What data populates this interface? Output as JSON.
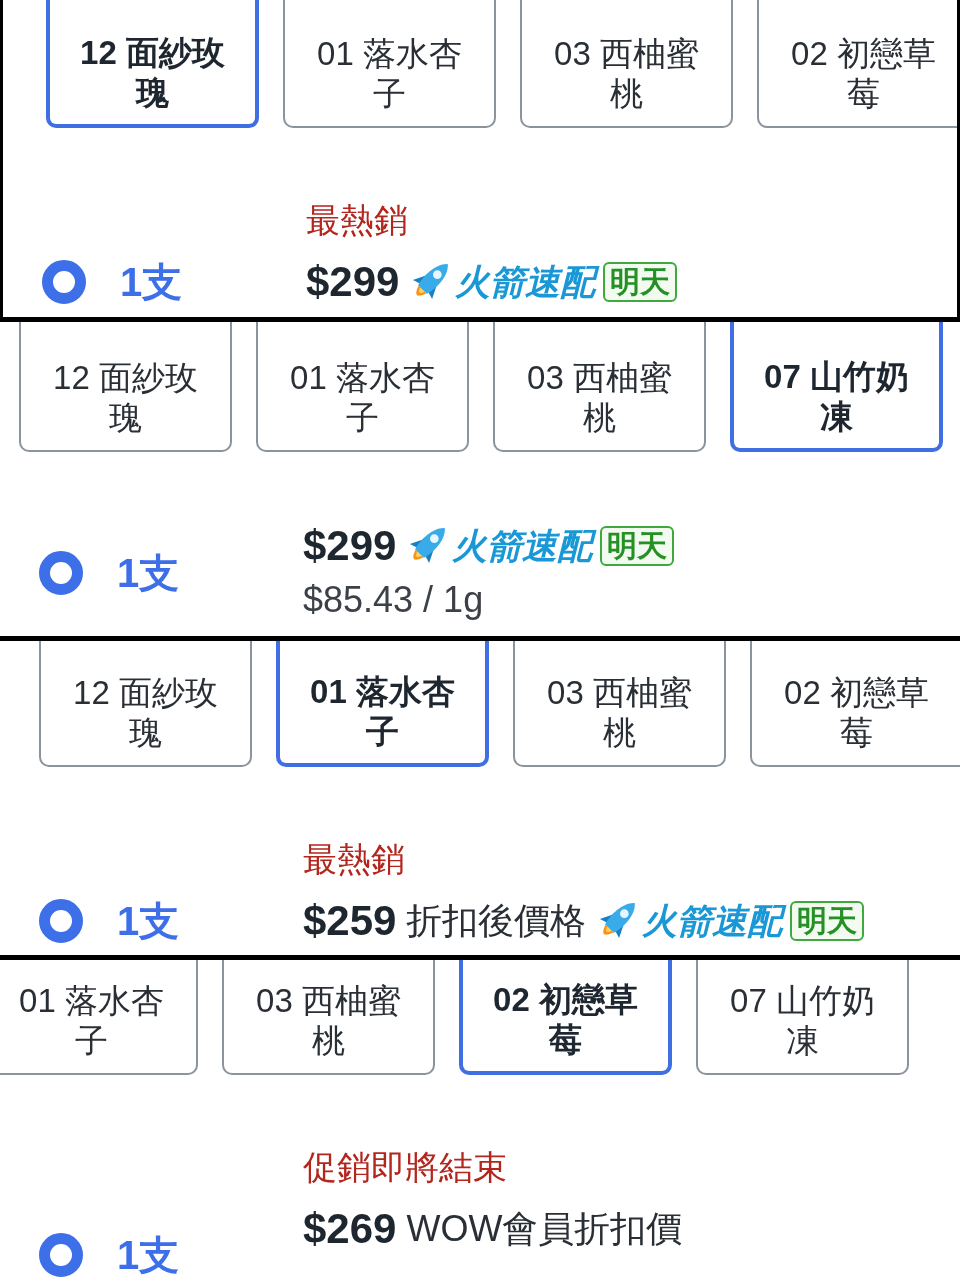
{
  "panels": [
    {
      "variants": [
        {
          "label": "12 面紗玫瑰",
          "selected": true
        },
        {
          "label": "01 落水杏子",
          "selected": false
        },
        {
          "label": "03 西柚蜜桃",
          "selected": false
        },
        {
          "label": "02 初戀草莓",
          "selected": false
        }
      ],
      "option": {
        "tag": "最熱銷",
        "selected": true,
        "quantity": "1支",
        "price": "$299",
        "delivery": {
          "label": "火箭速配",
          "badge": "明天"
        }
      }
    },
    {
      "variants": [
        {
          "label": "12 面紗玫瑰",
          "selected": false
        },
        {
          "label": "01 落水杏子",
          "selected": false
        },
        {
          "label": "03 西柚蜜桃",
          "selected": false
        },
        {
          "label": "07 山竹奶凍",
          "selected": true
        }
      ],
      "option": {
        "selected": true,
        "quantity": "1支",
        "price": "$299",
        "delivery": {
          "label": "火箭速配",
          "badge": "明天"
        },
        "unit_price": "$85.43 / 1g"
      }
    },
    {
      "variants": [
        {
          "label": "12 面紗玫瑰",
          "selected": false
        },
        {
          "label": "01 落水杏子",
          "selected": true
        },
        {
          "label": "03 西柚蜜桃",
          "selected": false
        },
        {
          "label": "02 初戀草莓",
          "selected": false
        }
      ],
      "option": {
        "tag": "最熱銷",
        "selected": true,
        "quantity": "1支",
        "price": "$259",
        "price_note": "折扣後價格",
        "delivery": {
          "label": "火箭速配",
          "badge": "明天"
        }
      }
    },
    {
      "variants": [
        {
          "label": "01 落水杏子",
          "selected": false
        },
        {
          "label": "03 西柚蜜桃",
          "selected": false
        },
        {
          "label": "02 初戀草莓",
          "selected": true
        },
        {
          "label": "07 山竹奶凍",
          "selected": false
        }
      ],
      "option": {
        "tag": "促銷即將結束",
        "selected": true,
        "quantity": "1支",
        "price": "$269",
        "price_note": "WOW會員折扣價"
      }
    }
  ]
}
